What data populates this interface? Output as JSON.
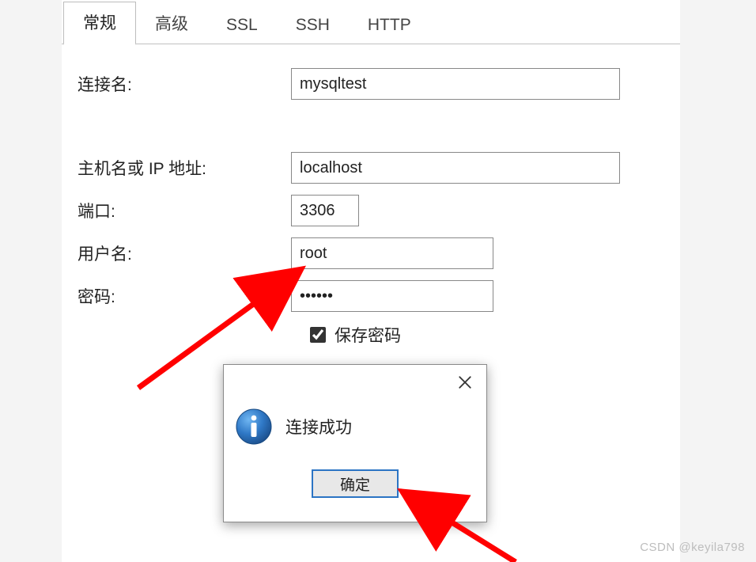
{
  "tabs": {
    "general": "常规",
    "advanced": "高级",
    "ssl": "SSL",
    "ssh": "SSH",
    "http": "HTTP"
  },
  "labels": {
    "conn_name": "连接名:",
    "host": "主机名或 IP 地址:",
    "port": "端口:",
    "user": "用户名:",
    "password": "密码:",
    "save_pw": "保存密码"
  },
  "fields": {
    "conn_name": "mysqltest",
    "host": "localhost",
    "port": "3306",
    "user": "root",
    "password": "••••••"
  },
  "dialog": {
    "message": "连接成功",
    "ok": "确定"
  },
  "watermark": "CSDN @keyila798"
}
